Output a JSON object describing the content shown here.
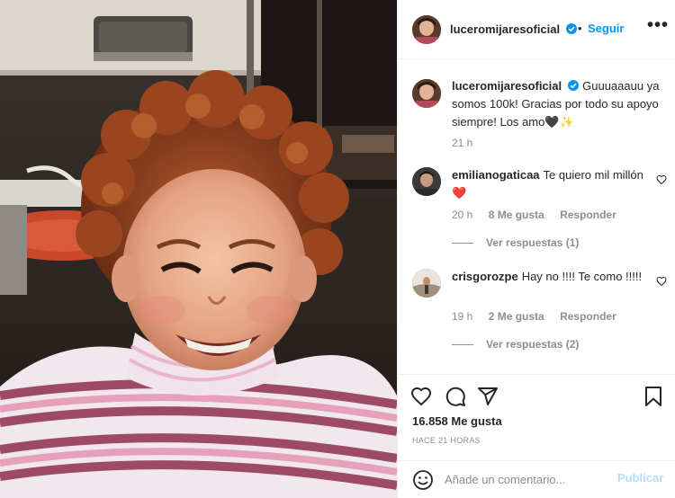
{
  "post": {
    "username": "luceromijaresoficial",
    "follow_label": "Seguir",
    "separator": "•",
    "more_label": "•••"
  },
  "caption": {
    "username": "luceromijaresoficial",
    "text": "Guuuaaauu ya somos 100k! Gracias por todo su apoyo siempre! Los amo🖤✨",
    "time": "21 h"
  },
  "comments": [
    {
      "username": "emilianogaticaa",
      "text": "Te quiero mil millón ❤️",
      "time": "20 h",
      "likes": "8 Me gusta",
      "reply_label": "Responder",
      "view_replies": "Ver respuestas (1)"
    },
    {
      "username": "crisgorozpe",
      "text": "Hay no !!!! Te como !!!!!",
      "time": "19 h",
      "likes": "2 Me gusta",
      "reply_label": "Responder",
      "view_replies": "Ver respuestas (2)"
    }
  ],
  "actions": {
    "likes_count": "16.858 Me gusta",
    "posted": "HACE 21 HORAS"
  },
  "add_comment": {
    "placeholder": "Añade un comentario...",
    "publish_label": "Publicar"
  },
  "colors": {
    "accent": "#0095f6",
    "publish_disabled": "#b2dffc",
    "heart": "#ed4956",
    "muted": "#8e8e8e"
  },
  "icons": [
    "verified-badge-icon",
    "more-options-icon",
    "heart-icon",
    "comment-icon",
    "share-icon",
    "save-icon",
    "emoji-icon"
  ]
}
